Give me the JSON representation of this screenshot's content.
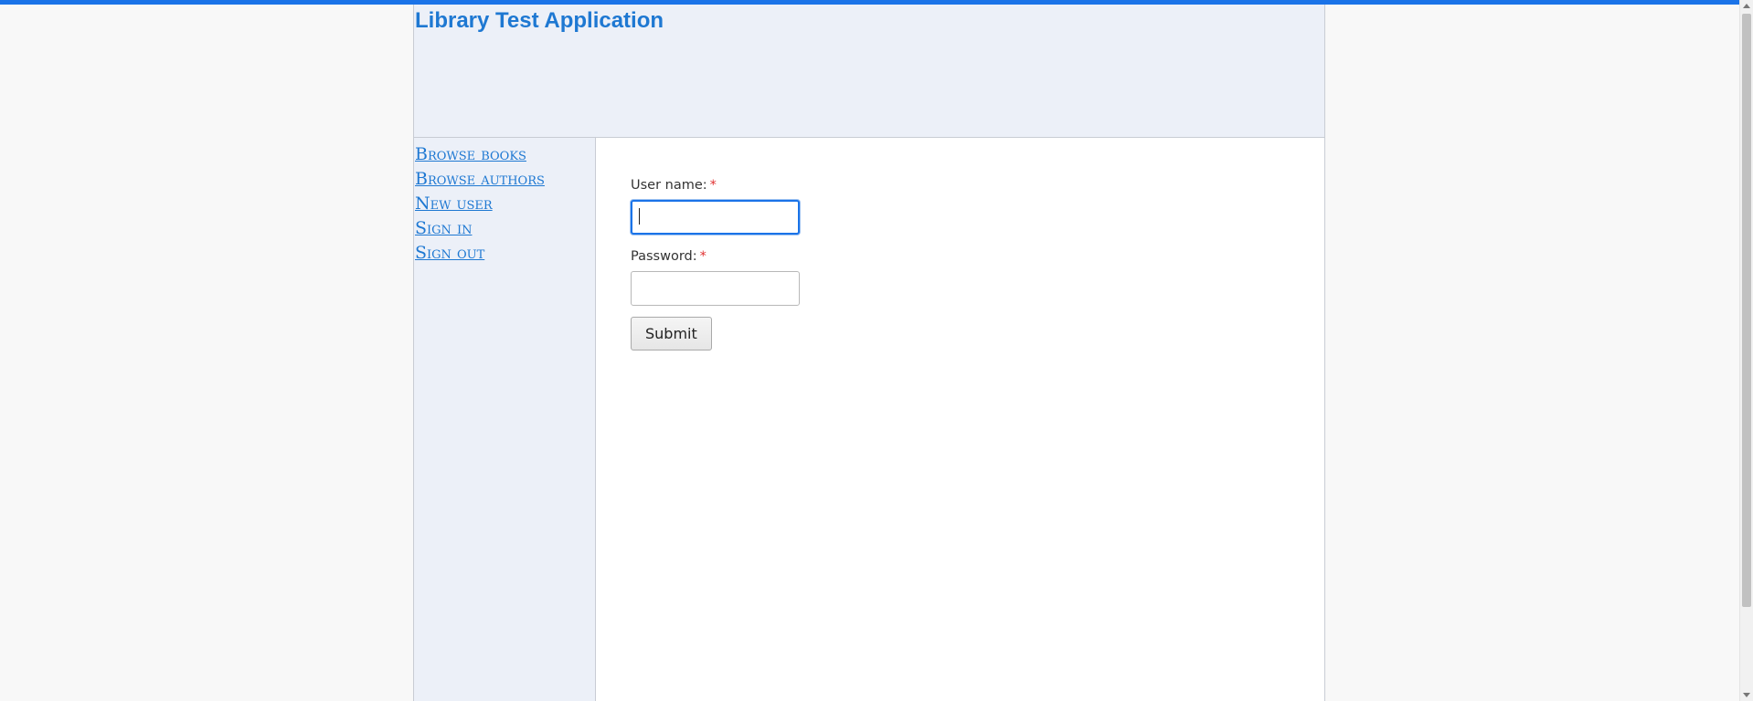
{
  "header": {
    "title": "Library Test Application"
  },
  "sidebar": {
    "items": [
      {
        "label": "Browse books"
      },
      {
        "label": "Browse authors"
      },
      {
        "label": "New user"
      },
      {
        "label": "Sign in"
      },
      {
        "label": "Sign out"
      }
    ]
  },
  "login_form": {
    "username_label": "User name:",
    "password_label": "Password:",
    "required_marker": "*",
    "username_value": "",
    "password_value": "",
    "submit_label": "Submit"
  },
  "colors": {
    "accent": "#1a73e8",
    "link": "#1e78d2",
    "required": "#e03131",
    "header_bg": "#ecf0f8"
  }
}
